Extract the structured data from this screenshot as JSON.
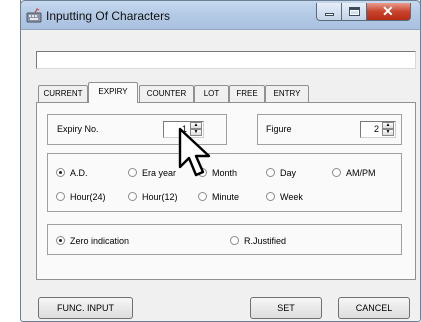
{
  "window": {
    "title": "Inputting Of Characters"
  },
  "text_input": {
    "value": ""
  },
  "tabs": [
    {
      "label": "CURRENT",
      "active": false
    },
    {
      "label": "EXPIRY",
      "active": true
    },
    {
      "label": "COUNTER",
      "active": false
    },
    {
      "label": "LOT",
      "active": false
    },
    {
      "label": "FREE",
      "active": false
    },
    {
      "label": "ENTRY",
      "active": false
    }
  ],
  "expiry": {
    "expiry_no_label": "Expiry No.",
    "expiry_no_value": "1",
    "figure_label": "Figure",
    "figure_value": "2"
  },
  "date_units": [
    {
      "label": "A.D.",
      "selected": true
    },
    {
      "label": "Era year",
      "selected": false
    },
    {
      "label": "Month",
      "selected": false
    },
    {
      "label": "Day",
      "selected": false
    },
    {
      "label": "AM/PM",
      "selected": false
    },
    {
      "label": "Hour(24)",
      "selected": false
    },
    {
      "label": "Hour(12)",
      "selected": false
    },
    {
      "label": "Minute",
      "selected": false
    },
    {
      "label": "Week",
      "selected": false
    }
  ],
  "indication": [
    {
      "label": "Zero indication",
      "selected": true
    },
    {
      "label": "R.Justified",
      "selected": false
    }
  ],
  "buttons": {
    "func_input": "FUNC. INPUT",
    "set": "SET",
    "cancel": "CANCEL"
  },
  "icons": {
    "app": "keyboard-app-icon",
    "minimize": "minimize-icon",
    "maximize": "maximize-icon",
    "close": "close-icon",
    "cursor": "mouse-pointer-icon",
    "spin_up": "arrow-up-icon",
    "spin_down": "arrow-down-icon"
  },
  "colors": {
    "close_button": "#c9432c",
    "titlebar": "#b5cbe6",
    "panel": "#fafafa"
  }
}
